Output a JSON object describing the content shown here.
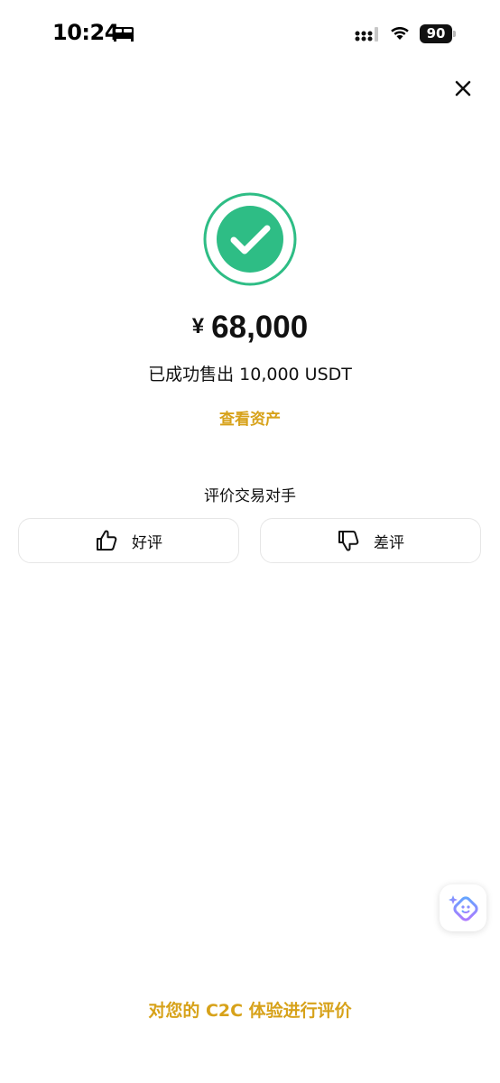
{
  "status_bar": {
    "time": "10:24",
    "battery_level": "90",
    "icons": [
      "bed-icon",
      "signal-icon",
      "wifi-icon",
      "battery-icon"
    ]
  },
  "header": {
    "close_icon": "close-icon"
  },
  "result": {
    "status_icon": "check-circle-icon",
    "currency_symbol": "¥",
    "amount": "68,000",
    "message": "已成功售出 10,000 USDT",
    "view_assets_label": "查看资产"
  },
  "rating": {
    "title": "评价交易对手",
    "positive_label": "好评",
    "positive_icon": "thumbs-up-icon",
    "negative_label": "差评",
    "negative_icon": "thumbs-down-icon"
  },
  "assistant": {
    "icon": "assistant-icon"
  },
  "footer": {
    "feedback_label": "对您的 C2C 体验进行评价"
  },
  "colors": {
    "accent": "#d7a21a",
    "success": "#2ebd85",
    "text": "#111111",
    "border": "#e6e6e6",
    "background": "#ffffff"
  }
}
